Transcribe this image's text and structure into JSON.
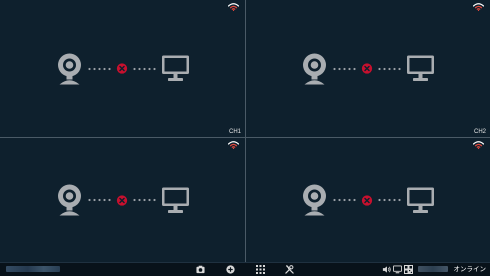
{
  "panes": [
    {
      "channel_label": "CH1",
      "status": "disconnected"
    },
    {
      "channel_label": "CH2",
      "status": "disconnected"
    },
    {
      "channel_label": "",
      "status": "disconnected"
    },
    {
      "channel_label": "",
      "status": "disconnected"
    }
  ],
  "taskbar": {
    "status_text": "オンライン"
  },
  "icons": {
    "wifi": "wifi-icon",
    "camera": "webcam-icon",
    "monitor": "monitor-icon",
    "error": "error-x-icon",
    "record": "record-icon",
    "add": "add-icon",
    "grid": "grid-layout-icon",
    "settings": "tools-icon",
    "volume": "volume-icon",
    "display": "display-icon",
    "qr": "qr-code-icon"
  },
  "colors": {
    "pane_bg": "#0e202d",
    "icon_gray": "#a9adb1",
    "error_red": "#c8102e",
    "wifi_red": "#e0473c"
  }
}
